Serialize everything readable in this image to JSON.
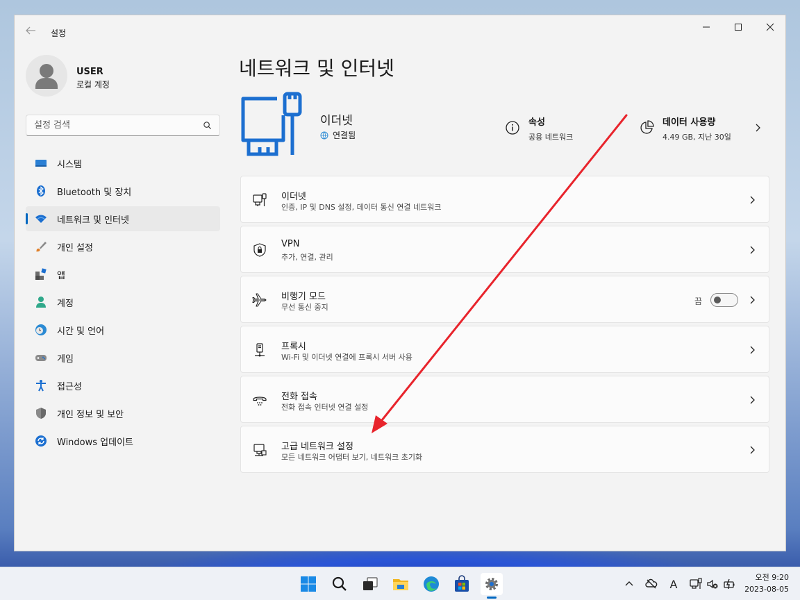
{
  "window": {
    "title": "설정"
  },
  "user": {
    "name": "USER",
    "account_type": "로컬 계정"
  },
  "search": {
    "placeholder": "설정 검색"
  },
  "nav": [
    {
      "label": "시스템",
      "icon": "system-icon"
    },
    {
      "label": "Bluetooth 및 장치",
      "icon": "bluetooth-icon"
    },
    {
      "label": "네트워크 및 인터넷",
      "icon": "wifi-icon",
      "active": true
    },
    {
      "label": "개인 설정",
      "icon": "brush-icon"
    },
    {
      "label": "앱",
      "icon": "apps-icon"
    },
    {
      "label": "계정",
      "icon": "account-icon"
    },
    {
      "label": "시간 및 언어",
      "icon": "clock-globe-icon"
    },
    {
      "label": "게임",
      "icon": "gamepad-icon"
    },
    {
      "label": "접근성",
      "icon": "accessibility-icon"
    },
    {
      "label": "개인 정보 및 보안",
      "icon": "shield-icon"
    },
    {
      "label": "Windows 업데이트",
      "icon": "update-icon"
    }
  ],
  "main": {
    "title": "네트워크 및 인터넷",
    "hero": {
      "name": "이더넷",
      "status": "연결됨"
    },
    "properties": {
      "title": "속성",
      "subtitle": "공용 네트워크"
    },
    "data_usage": {
      "title": "데이터 사용량",
      "subtitle": "4.49 GB, 지난 30일"
    },
    "cards": [
      {
        "title": "이더넷",
        "subtitle": "인증, IP 및 DNS 설정, 데이터 통신 연결 네트워크",
        "icon": "ethernet-icon"
      },
      {
        "title": "VPN",
        "subtitle": "추가, 연결, 관리",
        "icon": "vpn-shield-icon"
      },
      {
        "title": "비행기 모드",
        "subtitle": "무선 통신 중지",
        "icon": "airplane-icon",
        "toggle_label": "끔",
        "toggle_on": false
      },
      {
        "title": "프록시",
        "subtitle": "Wi-Fi 및 이더넷 연결에 프록시 서버 사용",
        "icon": "proxy-icon"
      },
      {
        "title": "전화 접속",
        "subtitle": "전화 접속 인터넷 연결 설정",
        "icon": "dialup-icon"
      },
      {
        "title": "고급 네트워크 설정",
        "subtitle": "모든 네트워크 어댑터 보기, 네트워크 초기화",
        "icon": "advanced-network-icon"
      }
    ]
  },
  "taskbar": {
    "apps": [
      "start-icon",
      "search-icon",
      "task-view-icon",
      "file-explorer-icon",
      "edge-icon",
      "store-icon",
      "settings-icon"
    ],
    "tray": {
      "ime": "A"
    },
    "clock": {
      "time": "오전 9:20",
      "date": "2023-08-05"
    }
  },
  "colors": {
    "accent": "#0067c0",
    "annotation_arrow": "#e8242c"
  }
}
